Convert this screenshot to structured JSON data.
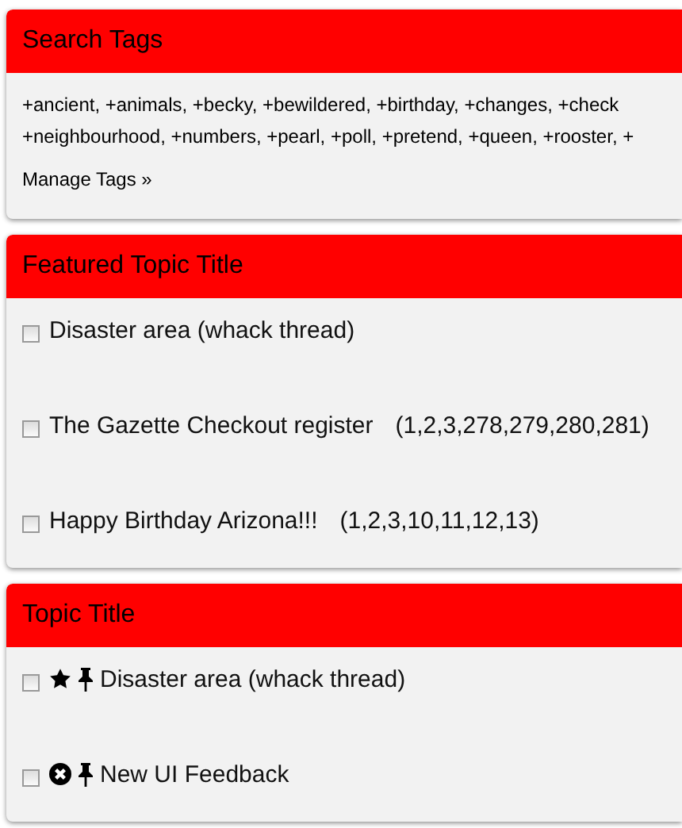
{
  "panels": [
    {
      "title": "Search Tags",
      "kind": "tags",
      "tag_lines": [
        "+ancient, +animals, +becky, +bewildered, +birthday, +changes, +check",
        "+neighbourhood, +numbers, +pearl, +poll, +pretend, +queen, +rooster, +"
      ],
      "link": "Manage Tags »"
    },
    {
      "title": "Featured Topic Title",
      "kind": "topics",
      "topics": [
        {
          "title": "Disaster area (whack thread)",
          "checked": false
        },
        {
          "title": "The Gazette Checkout register",
          "pages": "(1,2,3,278,279,280,281)",
          "checked": false
        },
        {
          "title": "Happy Birthday Arizona!!!",
          "pages": "(1,2,3,10,11,12,13)",
          "checked": false
        }
      ]
    },
    {
      "title": "Topic Title",
      "kind": "topics",
      "topics": [
        {
          "title": "Disaster area (whack thread)",
          "checked": false,
          "starred": true,
          "closed": false,
          "pinned": true
        },
        {
          "title": "New UI Feedback",
          "checked": false,
          "starred": false,
          "closed": true,
          "pinned": true
        }
      ]
    }
  ]
}
